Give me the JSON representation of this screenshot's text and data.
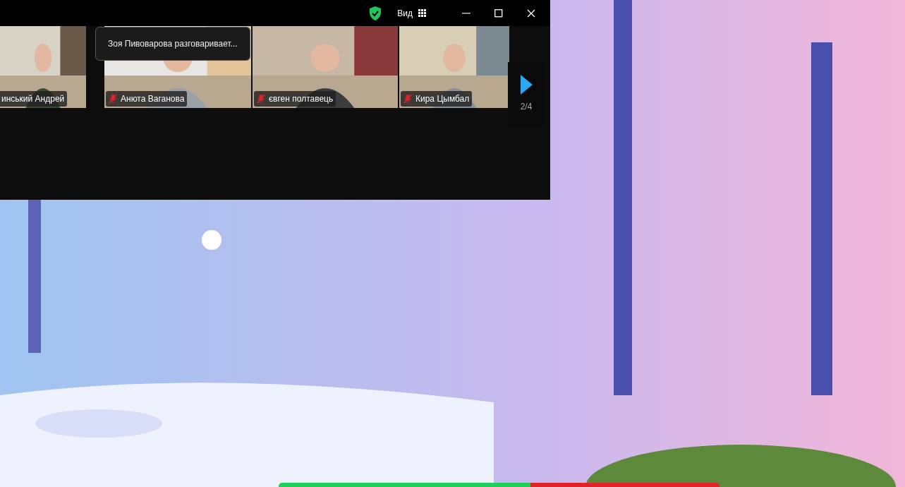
{
  "title_bar": {
    "secure": true,
    "view_label": "Вид"
  },
  "tooltip": {
    "text": "Зоя Пивоварова разговаривает..."
  },
  "participants": [
    {
      "name": "инський Андрей",
      "muted": false
    },
    {
      "name": "Анюта Ваганова",
      "muted": true
    },
    {
      "name": "євген  полтавець",
      "muted": true
    },
    {
      "name": "Кира Цымбал",
      "muted": true
    }
  ],
  "pager": {
    "text": "2/4"
  }
}
